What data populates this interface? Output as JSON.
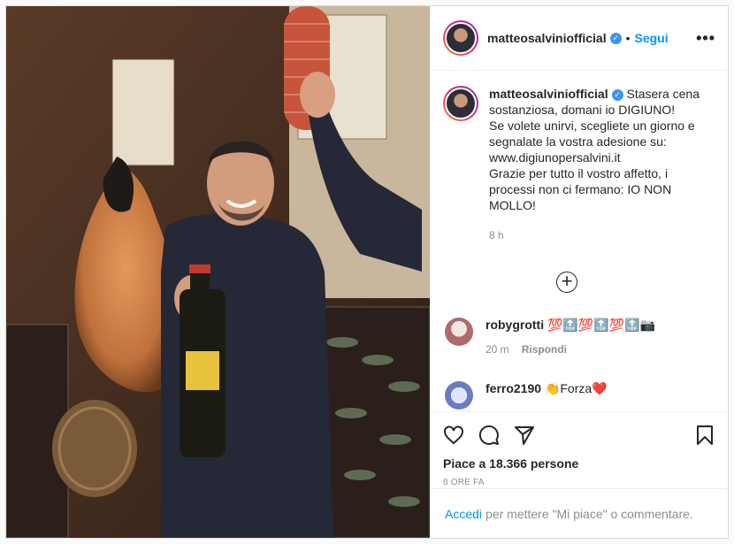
{
  "post": {
    "username": "matteosalviniofficial",
    "verified_icon": "verified-badge-icon",
    "separator": "•",
    "follow_label": "Segui",
    "more_label": "•••",
    "caption": "Stasera cena sostanziosa, domani io DIGIUNO!\nSe volete unirvi, scegliete un giorno e segnalate la vostra adesione su: www.digiunopersalvini.it\nGrazie per tutto il vostro affetto, i processi non ci fermano: IO NON MOLLO!",
    "caption_time": "8 h",
    "load_more_label": "+"
  },
  "comments": [
    {
      "username": "robygrotti",
      "text": "💯🔝💯🔝💯🔝📷",
      "time": "20 m",
      "reply_label": "Rispondi"
    },
    {
      "username": "ferro2190",
      "text": "👏Forza❤️"
    }
  ],
  "actions": {
    "likes_text": "Piace a 18.366 persone",
    "posted_ago": "8 ORE FA"
  },
  "comment_box": {
    "login_link": "Accedi",
    "prompt": "per mettere \"Mi piace\" o commentare."
  },
  "colors": {
    "link": "#0095f6",
    "secondary_text": "#8e8e8e",
    "verified": "#3897f0"
  }
}
